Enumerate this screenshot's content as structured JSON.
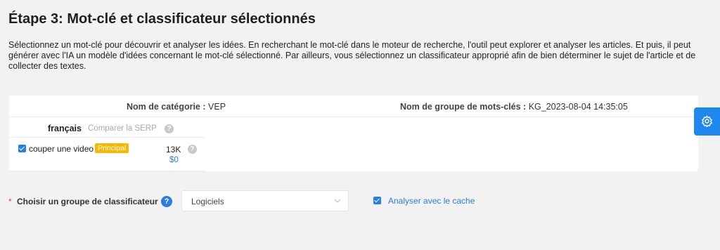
{
  "step": {
    "title": "Étape 3: Mot-clé et classificateur sélectionnés",
    "description": "Sélectionnez un mot-clé pour découvrir et analyser les idées. En recherchant le mot-clé dans le moteur de recherche, l'outil peut explorer et analyser les articles. Et puis, il peut générer avec l'IA un modèle d'idées concernant le mot-clé sélectionné. Par ailleurs, vous sélectionnez un classificateur approprié afin de bien déterminer le sujet de l'article et de collecter des textes."
  },
  "card": {
    "category_label": "Nom de catégorie :",
    "category_value": "VEP",
    "group_label": "Nom de groupe de mots-clés :",
    "group_value": "KG_2023-08-04 14:35:05",
    "language": "français",
    "compare_serp": "Comparer la SERP",
    "keyword": {
      "checked": true,
      "text": "couper une video",
      "badge": "Principal",
      "volume": "13K",
      "cpc": "$0"
    }
  },
  "form": {
    "required_mark": "*",
    "classifier_label": "Choisir un groupe de classificateur",
    "classifier_value": "Logiciels",
    "cache_checked": true,
    "cache_label": "Analyser avec le cache"
  },
  "colors": {
    "accent": "#2a7de1",
    "badge": "#f5b800",
    "background": "#f2f2f2"
  },
  "icons": {
    "help": "?",
    "settings": "gear-icon",
    "dropdown": "chevron-down-icon"
  }
}
